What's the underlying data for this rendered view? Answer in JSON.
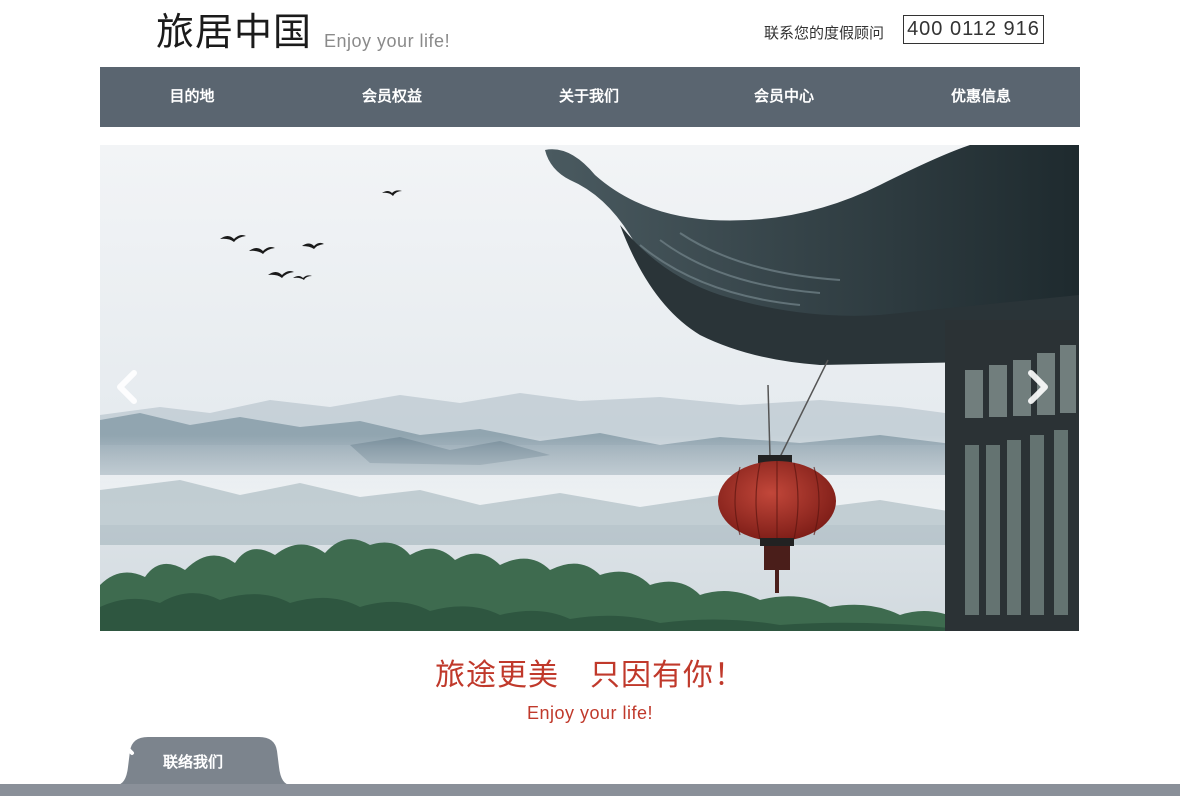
{
  "header": {
    "logo_cn": "旅居中国",
    "logo_en": "Enjoy your life!",
    "hotline_label": "联系您的度假顾问",
    "hotline_number": "400 0112 916"
  },
  "nav": {
    "items": [
      {
        "label": "目的地"
      },
      {
        "label": "会员权益"
      },
      {
        "label": "关于我们"
      },
      {
        "label": "会员中心"
      },
      {
        "label": "优惠信息"
      }
    ]
  },
  "banner": {
    "prev_icon": "chevron-left-icon",
    "next_icon": "chevron-right-icon"
  },
  "slogan": {
    "cn": "旅途更美　只因有你！",
    "en": "Enjoy your life!"
  },
  "contact": {
    "label": "联络我们",
    "close_icon": "close-icon"
  },
  "colors": {
    "nav_bg": "#5a6570",
    "accent": "#c0392b",
    "footer_bar": "#8a9099"
  }
}
